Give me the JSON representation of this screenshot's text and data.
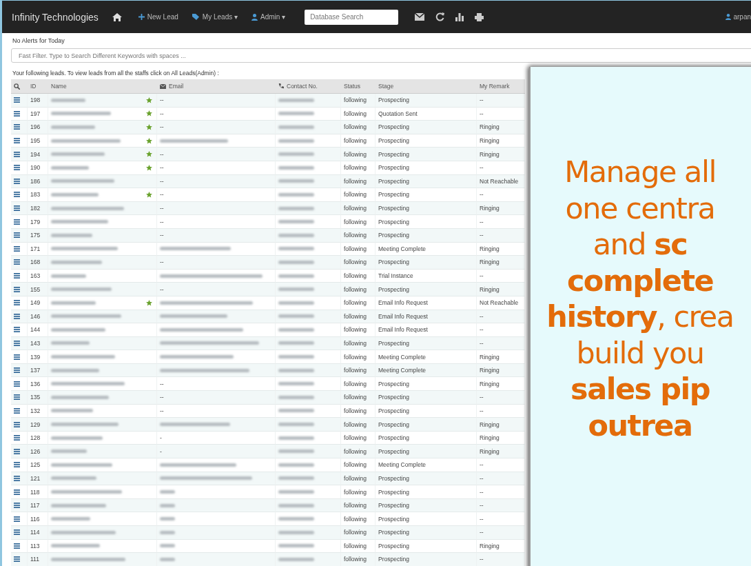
{
  "navbar": {
    "brand": "Infinity Technologies",
    "links": [
      {
        "label": "New Lead",
        "kind": "plus"
      },
      {
        "label": "My Leads ▾",
        "kind": "tag"
      },
      {
        "label": "Admin ▾",
        "kind": "admin"
      }
    ],
    "search": {
      "placeholder": "Database Search"
    },
    "user": "arpan"
  },
  "alerts": "No Alerts for Today",
  "filter": {
    "placeholder": "Fast Filter. Type to Search Different Keywords with spaces ..."
  },
  "intro": "Your following leads. To view leads from all the staffs click on All Leads(Admin) :",
  "table": {
    "columns": [
      "ID",
      "Name",
      "Email",
      "Contact No.",
      "Status",
      "Stage",
      "My Remark"
    ],
    "rows": [
      {
        "id": "198",
        "starred": true,
        "email": "--",
        "status": "following",
        "stage": "Prospecting",
        "remark": "--"
      },
      {
        "id": "197",
        "starred": true,
        "email": "--",
        "status": "following",
        "stage": "Quotation Sent",
        "remark": "--"
      },
      {
        "id": "196",
        "starred": true,
        "email": "--",
        "status": "following",
        "stage": "Prospecting",
        "remark": "Ringing"
      },
      {
        "id": "195",
        "starred": true,
        "email_blurred": true,
        "status": "following",
        "stage": "Prospecting",
        "remark": "Ringing"
      },
      {
        "id": "194",
        "starred": true,
        "email": "--",
        "status": "following",
        "stage": "Prospecting",
        "remark": "Ringing"
      },
      {
        "id": "190",
        "starred": true,
        "email": "--",
        "status": "following",
        "stage": "Prospecting",
        "remark": "--"
      },
      {
        "id": "186",
        "starred": false,
        "email": "--",
        "status": "following",
        "stage": "Prospecting",
        "remark": "Not Reachable"
      },
      {
        "id": "183",
        "starred": true,
        "email": "--",
        "status": "following",
        "stage": "Prospecting",
        "remark": "--"
      },
      {
        "id": "182",
        "starred": false,
        "email": "--",
        "status": "following",
        "stage": "Prospecting",
        "remark": "Ringing"
      },
      {
        "id": "179",
        "starred": false,
        "email": "--",
        "status": "following",
        "stage": "Prospecting",
        "remark": "--"
      },
      {
        "id": "175",
        "starred": false,
        "email": "--",
        "status": "following",
        "stage": "Prospecting",
        "remark": "--"
      },
      {
        "id": "171",
        "starred": false,
        "email_blurred": true,
        "status": "following",
        "stage": "Meeting Complete",
        "remark": "Ringing"
      },
      {
        "id": "168",
        "starred": false,
        "email": "--",
        "status": "following",
        "stage": "Prospecting",
        "remark": "Ringing"
      },
      {
        "id": "163",
        "starred": false,
        "email_blurred": true,
        "status": "following",
        "stage": "Trial Instance",
        "remark": "--"
      },
      {
        "id": "155",
        "starred": false,
        "email": "--",
        "status": "following",
        "stage": "Prospecting",
        "remark": "Ringing"
      },
      {
        "id": "149",
        "starred": true,
        "email_blurred": true,
        "status": "following",
        "stage": "Email Info Request",
        "remark": "Not Reachable"
      },
      {
        "id": "146",
        "starred": false,
        "email_blurred": true,
        "status": "following",
        "stage": "Email Info Request",
        "remark": "--"
      },
      {
        "id": "144",
        "starred": false,
        "email_blurred": true,
        "status": "following",
        "stage": "Email Info Request",
        "remark": "--"
      },
      {
        "id": "143",
        "starred": false,
        "email_blurred": true,
        "status": "following",
        "stage": "Prospecting",
        "remark": "--"
      },
      {
        "id": "139",
        "starred": false,
        "email_blurred": true,
        "status": "following",
        "stage": "Meeting Complete",
        "remark": "Ringing"
      },
      {
        "id": "137",
        "starred": false,
        "email_blurred": true,
        "status": "following",
        "stage": "Meeting Complete",
        "remark": "Ringing"
      },
      {
        "id": "136",
        "starred": false,
        "email": "--",
        "status": "following",
        "stage": "Prospecting",
        "remark": "Ringing"
      },
      {
        "id": "135",
        "starred": false,
        "email": "--",
        "status": "following",
        "stage": "Prospecting",
        "remark": "--"
      },
      {
        "id": "132",
        "starred": false,
        "email": "--",
        "status": "following",
        "stage": "Prospecting",
        "remark": "--"
      },
      {
        "id": "129",
        "starred": false,
        "email_blurred": true,
        "status": "following",
        "stage": "Prospecting",
        "remark": "Ringing"
      },
      {
        "id": "128",
        "starred": false,
        "email": "-",
        "status": "following",
        "stage": "Prospecting",
        "remark": "Ringing"
      },
      {
        "id": "126",
        "starred": false,
        "email": "-",
        "status": "following",
        "stage": "Prospecting",
        "remark": "Ringing"
      },
      {
        "id": "125",
        "starred": false,
        "email_blurred": true,
        "status": "following",
        "stage": "Meeting Complete",
        "remark": "--"
      },
      {
        "id": "121",
        "starred": false,
        "email_blurred": true,
        "status": "following",
        "stage": "Prospecting",
        "remark": "--"
      },
      {
        "id": "118",
        "starred": false,
        "email_blurred": true,
        "status": "following",
        "stage": "Prospecting",
        "remark": "--"
      },
      {
        "id": "117",
        "starred": false,
        "email_blurred": true,
        "status": "following",
        "stage": "Prospecting",
        "remark": "--"
      },
      {
        "id": "116",
        "starred": false,
        "email_blurred": true,
        "status": "following",
        "stage": "Prospecting",
        "remark": "--"
      },
      {
        "id": "114",
        "starred": false,
        "email_blurred": true,
        "status": "following",
        "stage": "Prospecting",
        "remark": "--"
      },
      {
        "id": "113",
        "starred": false,
        "email_blurred": true,
        "status": "following",
        "stage": "Prospecting",
        "remark": "Ringing"
      },
      {
        "id": "111",
        "starred": false,
        "email_blurred": true,
        "status": "following",
        "stage": "Prospecting",
        "remark": "--"
      }
    ]
  },
  "promo": {
    "lines": [
      "Manage all",
      "one centra",
      "and **sc**",
      "**complete**",
      "**history**, crea",
      "build you",
      "**sales pip**",
      "**outrea**"
    ]
  }
}
